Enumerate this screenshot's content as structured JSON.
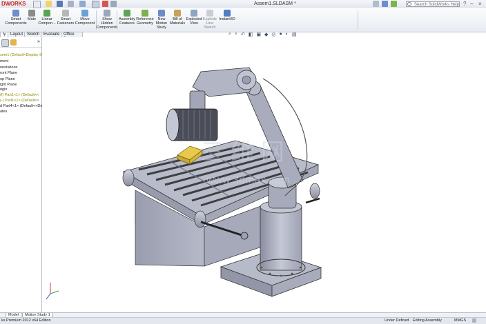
{
  "app": {
    "logo": "DWORKS",
    "doc_title": "Assem1.SLDASM *",
    "help_placeholder": "Search SolidWorks Help"
  },
  "ribbon": {
    "buttons": [
      {
        "label": "Smart\nComponents",
        "icon": "smart-components-icon"
      },
      {
        "label": "Mate",
        "icon": "mate-icon"
      },
      {
        "label": "Linear\nCompon...",
        "icon": "linear-pattern-icon"
      },
      {
        "label": "Smart\nFasteners",
        "icon": "smart-fasteners-icon"
      },
      {
        "label": "Move\nComponent",
        "icon": "move-component-icon"
      },
      {
        "label": "Show\nHidden\nComponents",
        "icon": "show-hidden-icon"
      },
      {
        "label": "Assembly\nFeatures",
        "icon": "assembly-features-icon"
      },
      {
        "label": "Reference\nGeometry",
        "icon": "reference-geometry-icon"
      },
      {
        "label": "New\nMotion\nStudy",
        "icon": "motion-study-icon"
      },
      {
        "label": "Bill of\nMaterials",
        "icon": "bom-icon"
      },
      {
        "label": "Exploded\nView",
        "icon": "exploded-view-icon"
      },
      {
        "label": "Explode\nLine\nSketch",
        "icon": "explode-line-icon"
      },
      {
        "label": "Instant3D",
        "icon": "instant3d-icon"
      }
    ]
  },
  "tabs": [
    "ly",
    "Layout",
    "Sketch",
    "Evaluate",
    "Office Products"
  ],
  "tree": {
    "items": [
      {
        "label": "sem1 (Default<Display St",
        "color": "#8a8a00"
      },
      {
        "label": "ment",
        "color": "#1a1a1a"
      },
      {
        "label": "nnotations",
        "color": "#1a1a1a"
      },
      {
        "label": "ront Plane",
        "color": "#1a1a1a"
      },
      {
        "label": "op Plane",
        "color": "#1a1a1a"
      },
      {
        "label": "ight Plane",
        "color": "#1a1a1a"
      },
      {
        "label": "rigin",
        "color": "#1a1a1a"
      },
      {
        "label": "(f) Part1<1> (Default<<",
        "color": "#8a8a00"
      },
      {
        "label": "(-) Part1<1> (Default<<",
        "color": "#8a8a00"
      },
      {
        "label": "d Part4<1> (Default<<Def",
        "color": "#1a1a1a"
      },
      {
        "label": "ates",
        "color": "#1a1a1a"
      }
    ]
  },
  "bottom_tabs": [
    "Model",
    "Motion Study 1"
  ],
  "status": {
    "left": "ks Premium 2012 x64 Edition",
    "state": "Under Defined",
    "mode": "Editing Assembly",
    "units": "MMGS"
  },
  "watermark": "www.3dmax.com"
}
